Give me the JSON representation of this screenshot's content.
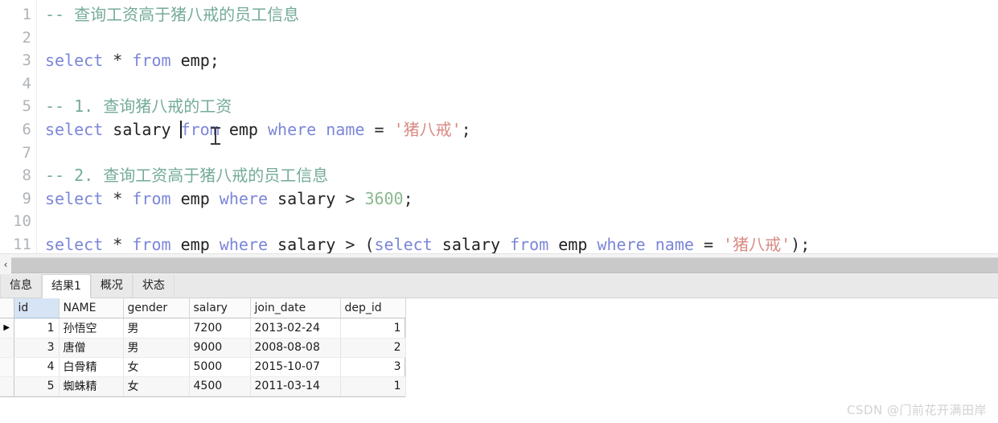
{
  "editor": {
    "line_numbers": [
      "1",
      "2",
      "3",
      "4",
      "5",
      "6",
      "7",
      "8",
      "9",
      "10",
      "11"
    ],
    "lines": [
      {
        "n": 1,
        "tokens": [
          {
            "t": "-- 查询工资高于猪八戒的员工信息",
            "c": "cmt"
          }
        ]
      },
      {
        "n": 2,
        "tokens": []
      },
      {
        "n": 3,
        "tokens": [
          {
            "t": "select",
            "c": "kw"
          },
          {
            "t": " ",
            "c": "pln"
          },
          {
            "t": "*",
            "c": "op"
          },
          {
            "t": " ",
            "c": "pln"
          },
          {
            "t": "from",
            "c": "kw"
          },
          {
            "t": " ",
            "c": "pln"
          },
          {
            "t": "emp",
            "c": "pln"
          },
          {
            "t": ";",
            "c": "op"
          }
        ]
      },
      {
        "n": 4,
        "tokens": []
      },
      {
        "n": 5,
        "tokens": [
          {
            "t": "-- 1. 查询猪八戒的工资",
            "c": "cmt"
          }
        ]
      },
      {
        "n": 6,
        "tokens": [
          {
            "t": "select",
            "c": "kw"
          },
          {
            "t": " ",
            "c": "pln"
          },
          {
            "t": "salary",
            "c": "pln"
          },
          {
            "t": " ",
            "c": "pln"
          },
          {
            "t": "CARET",
            "c": "caret"
          },
          {
            "t": "from",
            "c": "kw"
          },
          {
            "t": " ",
            "c": "pln"
          },
          {
            "t": "emp",
            "c": "pln"
          },
          {
            "t": " ",
            "c": "pln"
          },
          {
            "t": "where",
            "c": "kw"
          },
          {
            "t": " ",
            "c": "pln"
          },
          {
            "t": "name",
            "c": "kw"
          },
          {
            "t": " ",
            "c": "pln"
          },
          {
            "t": "=",
            "c": "op"
          },
          {
            "t": " ",
            "c": "pln"
          },
          {
            "t": "'猪八戒'",
            "c": "str"
          },
          {
            "t": ";",
            "c": "op"
          }
        ]
      },
      {
        "n": 7,
        "tokens": []
      },
      {
        "n": 8,
        "tokens": [
          {
            "t": "-- 2. 查询工资高于猪八戒的员工信息",
            "c": "cmt"
          }
        ]
      },
      {
        "n": 9,
        "tokens": [
          {
            "t": "select",
            "c": "kw"
          },
          {
            "t": " ",
            "c": "pln"
          },
          {
            "t": "*",
            "c": "op"
          },
          {
            "t": " ",
            "c": "pln"
          },
          {
            "t": "from",
            "c": "kw"
          },
          {
            "t": " ",
            "c": "pln"
          },
          {
            "t": "emp",
            "c": "pln"
          },
          {
            "t": " ",
            "c": "pln"
          },
          {
            "t": "where",
            "c": "kw"
          },
          {
            "t": " ",
            "c": "pln"
          },
          {
            "t": "salary",
            "c": "pln"
          },
          {
            "t": " ",
            "c": "pln"
          },
          {
            "t": ">",
            "c": "op"
          },
          {
            "t": " ",
            "c": "pln"
          },
          {
            "t": "3600",
            "c": "num"
          },
          {
            "t": ";",
            "c": "op"
          }
        ]
      },
      {
        "n": 10,
        "tokens": []
      },
      {
        "n": 11,
        "tokens": [
          {
            "t": "select",
            "c": "kw"
          },
          {
            "t": " ",
            "c": "pln"
          },
          {
            "t": "*",
            "c": "op"
          },
          {
            "t": " ",
            "c": "pln"
          },
          {
            "t": "from",
            "c": "kw"
          },
          {
            "t": " ",
            "c": "pln"
          },
          {
            "t": "emp",
            "c": "pln"
          },
          {
            "t": " ",
            "c": "pln"
          },
          {
            "t": "where",
            "c": "kw"
          },
          {
            "t": " ",
            "c": "pln"
          },
          {
            "t": "salary",
            "c": "pln"
          },
          {
            "t": " ",
            "c": "pln"
          },
          {
            "t": ">",
            "c": "op"
          },
          {
            "t": " ",
            "c": "pln"
          },
          {
            "t": "(",
            "c": "op"
          },
          {
            "t": "select",
            "c": "kw"
          },
          {
            "t": " ",
            "c": "pln"
          },
          {
            "t": "salary",
            "c": "pln"
          },
          {
            "t": " ",
            "c": "pln"
          },
          {
            "t": "from",
            "c": "kw"
          },
          {
            "t": " ",
            "c": "pln"
          },
          {
            "t": "emp",
            "c": "pln"
          },
          {
            "t": " ",
            "c": "pln"
          },
          {
            "t": "where",
            "c": "kw"
          },
          {
            "t": " ",
            "c": "pln"
          },
          {
            "t": "name",
            "c": "kw"
          },
          {
            "t": " ",
            "c": "pln"
          },
          {
            "t": "=",
            "c": "op"
          },
          {
            "t": " ",
            "c": "pln"
          },
          {
            "t": "'猪八戒'",
            "c": "str"
          },
          {
            "t": ")",
            "c": "op"
          },
          {
            "t": ";",
            "c": "op"
          }
        ]
      }
    ],
    "colors": {
      "keyword": "#7b86d8",
      "comment": "#74ab9a",
      "string": "#d98a83",
      "number": "#8ab98f",
      "plain": "#222222"
    }
  },
  "scrollbar": {
    "left_arrow": "‹"
  },
  "tabs": [
    {
      "label": "信息",
      "active": false
    },
    {
      "label": "结果1",
      "active": true
    },
    {
      "label": "概况",
      "active": false
    },
    {
      "label": "状态",
      "active": false
    }
  ],
  "grid": {
    "columns": [
      "id",
      "NAME",
      "gender",
      "salary",
      "join_date",
      "dep_id"
    ],
    "selected_column": "id",
    "row_marker": "▶",
    "rows": [
      {
        "marked": true,
        "id": "1",
        "name": "孙悟空",
        "gender": "男",
        "salary": "7200",
        "join_date": "2013-02-24",
        "dep_id": "1"
      },
      {
        "marked": false,
        "id": "3",
        "name": "唐僧",
        "gender": "男",
        "salary": "9000",
        "join_date": "2008-08-08",
        "dep_id": "2"
      },
      {
        "marked": false,
        "id": "4",
        "name": "白骨精",
        "gender": "女",
        "salary": "5000",
        "join_date": "2015-10-07",
        "dep_id": "3"
      },
      {
        "marked": false,
        "id": "5",
        "name": "蜘蛛精",
        "gender": "女",
        "salary": "4500",
        "join_date": "2011-03-14",
        "dep_id": "1"
      }
    ]
  },
  "watermark": {
    "text": "CSDN @门前花开满田岸"
  }
}
